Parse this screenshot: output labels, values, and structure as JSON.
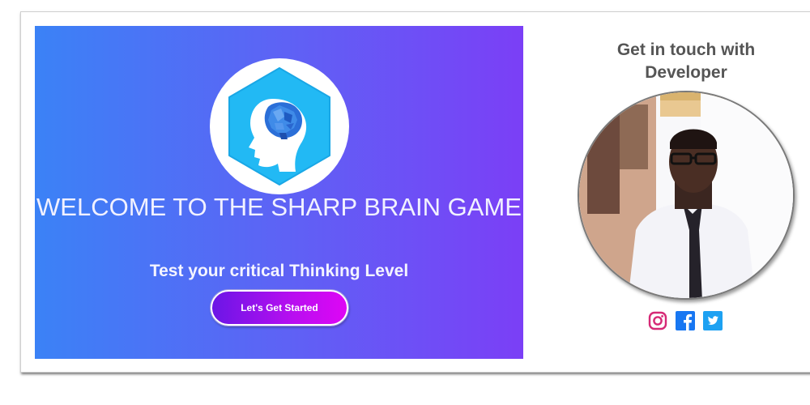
{
  "hero": {
    "title": "WELCOME TO THE SHARP BRAIN GAME",
    "subtitle": "Test your critical Thinking Level",
    "start_button_label": "Let's Get Started",
    "logo_icon": "brain-head-hexagon-icon",
    "colors": {
      "gradient_start": "#3b82f6",
      "gradient_end": "#7b3ff6",
      "button_start": "#6b16e6",
      "button_end": "#de06f5",
      "logo_hexagon": "#22b9f4"
    }
  },
  "contact": {
    "title": "Get in touch with Developer",
    "social": [
      {
        "name": "instagram-icon",
        "color": "#e1306c"
      },
      {
        "name": "facebook-icon",
        "color": "#1877f2"
      },
      {
        "name": "twitter-icon",
        "color": "#1da1f2"
      }
    ]
  }
}
